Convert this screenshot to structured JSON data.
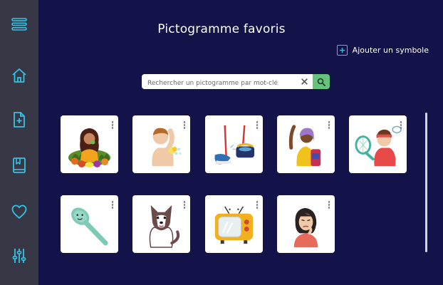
{
  "header": {
    "title": "Pictogramme favoris"
  },
  "actions": {
    "add_symbol_label": "Ajouter un symbole"
  },
  "search": {
    "placeholder": "Rechercher un pictogramme par mot-clé"
  },
  "sidebar": {
    "items": [
      {
        "icon": "menu-icon"
      },
      {
        "icon": "home-icon"
      },
      {
        "icon": "file-add-icon"
      },
      {
        "icon": "book-icon"
      },
      {
        "icon": "heart-icon"
      },
      {
        "icon": "sliders-icon"
      }
    ]
  },
  "colors": {
    "background": "#13134a",
    "sidebar": "#373746",
    "accent": "#36c2e3",
    "search_button": "#67c27c",
    "card": "#ffffff"
  },
  "pictograms": [
    {
      "icon": "woman-eating-vegetables-icon"
    },
    {
      "icon": "child-washing-icon"
    },
    {
      "icon": "cleaning-mop-bucket-icon"
    },
    {
      "icon": "student-backpack-icon"
    },
    {
      "icon": "boy-tennis-icon"
    },
    {
      "icon": "spoon-icon"
    },
    {
      "icon": "husky-dog-icon"
    },
    {
      "icon": "television-icon"
    },
    {
      "icon": "woman-thinking-icon"
    }
  ]
}
